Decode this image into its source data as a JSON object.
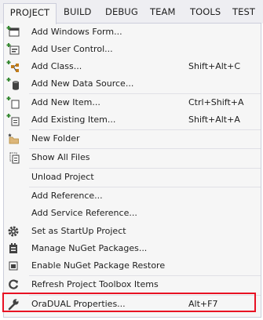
{
  "menubar": {
    "items": [
      "PROJECT",
      "BUILD",
      "DEBUG",
      "TEAM",
      "TOOLS",
      "TEST"
    ]
  },
  "menu": {
    "items": [
      {
        "label": "Add Windows Form...",
        "icon": "windows-form-icon"
      },
      {
        "label": "Add User Control...",
        "icon": "user-control-icon"
      },
      {
        "label": "Add Class...",
        "shortcut": "Shift+Alt+C",
        "icon": "add-class-icon"
      },
      {
        "label": "Add New Data Source...",
        "icon": "data-source-icon"
      },
      {
        "label": "Add New Item...",
        "shortcut": "Ctrl+Shift+A",
        "icon": "new-item-icon"
      },
      {
        "label": "Add Existing Item...",
        "shortcut": "Shift+Alt+A",
        "icon": "existing-item-icon"
      },
      {
        "label": "New Folder",
        "icon": "new-folder-icon"
      },
      {
        "label": "Show All Files",
        "icon": "show-all-files-icon"
      },
      {
        "label": "Unload Project"
      },
      {
        "label": "Add Reference..."
      },
      {
        "label": "Add Service Reference..."
      },
      {
        "label": "Set as StartUp Project",
        "icon": "gear-icon"
      },
      {
        "label": "Manage NuGet Packages...",
        "icon": "nuget-icon"
      },
      {
        "label": "Enable NuGet Package Restore",
        "icon": "package-restore-icon"
      },
      {
        "label": "Refresh Project Toolbox Items",
        "icon": "refresh-icon"
      },
      {
        "label": "OraDUAL Properties...",
        "shortcut": "Alt+F7",
        "icon": "wrench-icon"
      }
    ]
  },
  "colors": {
    "menubar_bg": "#eeeef2",
    "menu_bg": "#f6f6f6",
    "highlight": "#e81123"
  }
}
